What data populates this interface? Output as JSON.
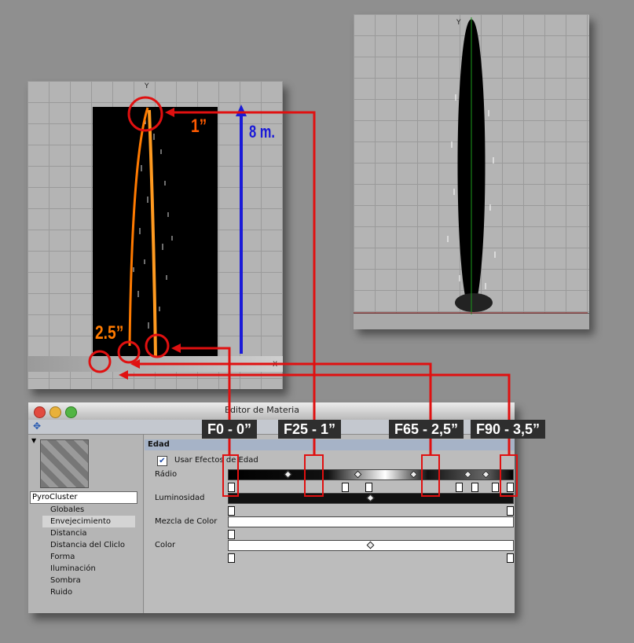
{
  "viewport_left": {
    "axis_y": "Y",
    "axis_x": "X"
  },
  "viewport_right": {
    "axis_y": "Y"
  },
  "annotations": {
    "time_top": "1”",
    "height": "8 m.",
    "time_bottom": "2.5”"
  },
  "frame_labels": [
    "F0 - 0”",
    "F25 - 1”",
    "F65 - 2,5”",
    "F90 - 3,5”"
  ],
  "editor": {
    "title": "Editor de Materia",
    "material_name": "PyroCluster",
    "nav_items": [
      "Globales",
      "Envejecimiento",
      "Distancia",
      "Distancia del Cliclo",
      "Forma",
      "Iluminación",
      "Sombra",
      "Ruido"
    ],
    "selected_nav": "Envejecimiento",
    "section_title": "Edad",
    "use_age_effects": "Usar Efectos de Edad",
    "use_age_effects_checked": true,
    "params": [
      "Rádio",
      "Luminosidad",
      "Mezcla de Color",
      "Color"
    ]
  },
  "colors": {
    "accent": "#e01010",
    "orange": "#ff7a00",
    "blue": "#1a1ad8"
  }
}
